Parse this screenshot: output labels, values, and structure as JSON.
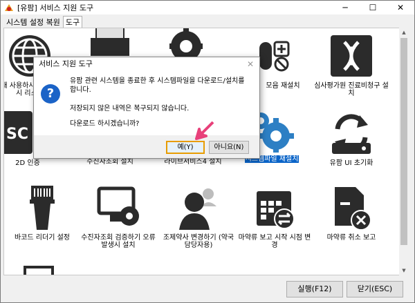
{
  "window": {
    "title": "[유팜] 서비스 지원 도구",
    "controls": [
      "minimize",
      "maximize",
      "close"
    ]
  },
  "tabs": [
    {
      "label": "시스템 설정 복원",
      "active": false
    },
    {
      "label": "도구",
      "active": true
    }
  ],
  "tiles": [
    {
      "label": "현재 사용하시는 정보 표시 리스트",
      "icon": "globe-icon"
    },
    {
      "label": "",
      "icon": "printer-icon"
    },
    {
      "label": "",
      "icon": "gear-wrench-icon"
    },
    {
      "label": "모음 재설치",
      "icon": "calculator-icon"
    },
    {
      "label": "심사평가원 진료비청구 설치",
      "icon": "dna-icon"
    },
    {
      "label": "2D 인증",
      "icon": "sd-card-icon"
    },
    {
      "label": "수진자조회 설치",
      "icon": "id-card-icon"
    },
    {
      "label": "라이브서비스4 설치",
      "icon": "monitor-icon"
    },
    {
      "label": "시스템파일 재설치",
      "icon": "gears-icon",
      "selected": true
    },
    {
      "label": "유팜 UI 초기화",
      "icon": "refresh-drive-icon"
    },
    {
      "label": "바코드 리더기 설정",
      "icon": "barcode-scanner-icon"
    },
    {
      "label": "수진자조회 검증하기 오류 발생시 설치",
      "icon": "monitor-gear-icon"
    },
    {
      "label": "조제약사 변경하기 (약국 담당자용)",
      "icon": "users-icon"
    },
    {
      "label": "마약류 보고 시작 시점 변경",
      "icon": "calendar-icon"
    },
    {
      "label": "마약류 취소 보고",
      "icon": "document-cancel-icon"
    }
  ],
  "buttons": {
    "run": "실행(F12)",
    "close": "닫기(ESC)"
  },
  "dialog": {
    "title": "서비스 지원 도구",
    "line1": "유팜 관련 시스템을 종료한 후 시스템파일을 다운로드/설치를 합니다.",
    "line2": "저장되지 않은 내역은 복구되지 않습니다.",
    "line3": "다운로드 하시겠습니까?",
    "yes": "예(Y)",
    "no": "아니요(N)"
  },
  "colors": {
    "icon": "#2b2b2b",
    "selection": "#0a64c8",
    "question": "#1b63c7",
    "highlight": "#e89c00",
    "pointer": "#e8407a"
  }
}
